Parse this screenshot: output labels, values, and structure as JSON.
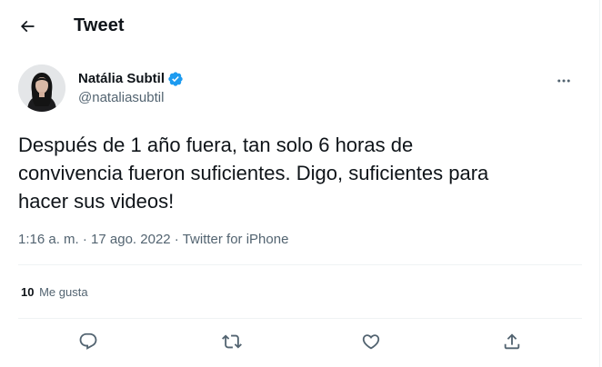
{
  "header": {
    "title": "Tweet",
    "back_icon": "arrow-left-icon"
  },
  "author": {
    "display_name": "Natália Subtil",
    "handle": "@nataliasubtil",
    "verified": true,
    "verified_color": "#1d9bf0",
    "more_icon": "more-horizontal-icon"
  },
  "tweet": {
    "text": "Después de 1 año fuera, tan solo 6 horas de\nconvivencia fueron suficientes. Digo, suficientes para\nhacer sus videos!",
    "time": "1:16 a. m.",
    "separator1": " · ",
    "date": "17 ago. 2022",
    "separator2": " · ",
    "source": "Twitter for iPhone"
  },
  "stats": {
    "likes_count": "10",
    "likes_label": "Me gusta"
  },
  "actions": {
    "reply_icon": "reply-icon",
    "retweet_icon": "retweet-icon",
    "like_icon": "heart-icon",
    "share_icon": "share-icon"
  },
  "colors": {
    "text_primary": "#0f1419",
    "text_secondary": "#536471",
    "divider": "#eff3f4",
    "accent": "#1d9bf0"
  }
}
